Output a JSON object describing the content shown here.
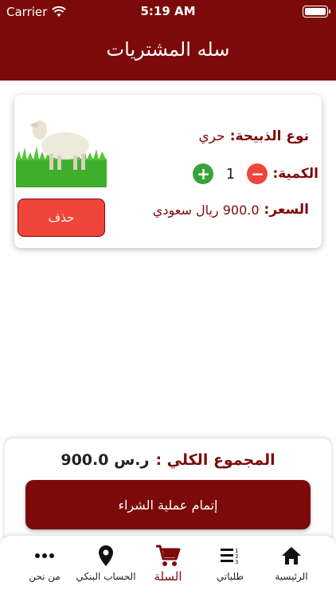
{
  "status_bar": {
    "carrier": "Carrier",
    "time": "5:19 AM"
  },
  "header": {
    "title": "سله المشتريات"
  },
  "cart_item": {
    "type_label": "نوع الذبيحة:",
    "type_value": "حري",
    "quantity_label": "الكمية:",
    "quantity": "1",
    "price_label": "السعر:",
    "price_value": "900.0 ريال سعودي",
    "delete_label": "حذف"
  },
  "summary": {
    "total_label": "المجموع الكلي :",
    "total_value": "900.0 ر.س",
    "checkout_label": "إتمام عملية الشراء"
  },
  "tab_bar": {
    "tabs": [
      {
        "label": "الرئيسية",
        "icon": "home-icon"
      },
      {
        "label": "طلباتي",
        "icon": "orders-list-icon"
      },
      {
        "label": "السلة",
        "icon": "cart-icon",
        "active": true
      },
      {
        "label": "الحساب البنكي",
        "icon": "location-pin-icon"
      },
      {
        "label": "من نحن",
        "icon": "more-dots-icon"
      }
    ]
  },
  "colors": {
    "primary": "#7d0a0a",
    "danger": "#f0453a",
    "success": "#38a33c"
  }
}
